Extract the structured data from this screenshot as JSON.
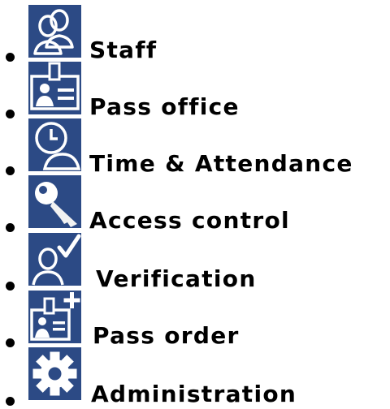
{
  "menu": {
    "items": [
      {
        "label": "Staff",
        "icon": "staff-people-icon"
      },
      {
        "label": "Pass office",
        "icon": "id-badge-icon"
      },
      {
        "label": "Time & Attendance",
        "icon": "clock-person-icon"
      },
      {
        "label": "Access control",
        "icon": "key-icon"
      },
      {
        "label": "Verification",
        "icon": "person-checkmark-icon"
      },
      {
        "label": "Pass order",
        "icon": "id-badge-plus-icon"
      },
      {
        "label": "Administration",
        "icon": "gear-icon"
      }
    ]
  },
  "colors": {
    "icon_background": "#2c4a85",
    "icon_foreground": "#ffffff",
    "text": "#000000",
    "page_background": "#ffffff"
  }
}
